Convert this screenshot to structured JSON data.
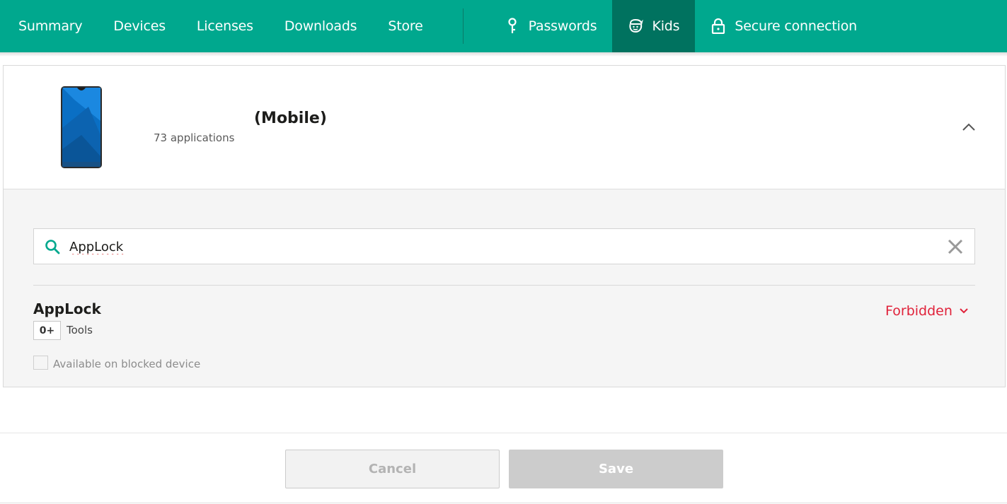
{
  "nav": {
    "items": [
      {
        "label": "Summary"
      },
      {
        "label": "Devices"
      },
      {
        "label": "Licenses"
      },
      {
        "label": "Downloads"
      },
      {
        "label": "Store"
      }
    ],
    "secondary": [
      {
        "label": "Passwords",
        "icon": "key-icon"
      },
      {
        "label": "Kids",
        "icon": "kids-icon",
        "active": true
      },
      {
        "label": "Secure connection",
        "icon": "lock-icon"
      }
    ]
  },
  "device": {
    "name": "(Mobile)",
    "app_count": "73 applications",
    "icon": "smartphone-icon"
  },
  "search": {
    "value": "AppLock",
    "icon": "search-icon",
    "clear_icon": "close-icon"
  },
  "app": {
    "name": "AppLock",
    "age_rating": "0+",
    "category": "Tools",
    "status": "Forbidden",
    "checkbox_label": "Available on blocked device",
    "checkbox_checked": false
  },
  "actions": {
    "cancel_label": "Cancel",
    "save_label": "Save"
  },
  "colors": {
    "brand": "#00a88e",
    "brand_dark": "#00725f",
    "forbidden": "#e0223a"
  }
}
